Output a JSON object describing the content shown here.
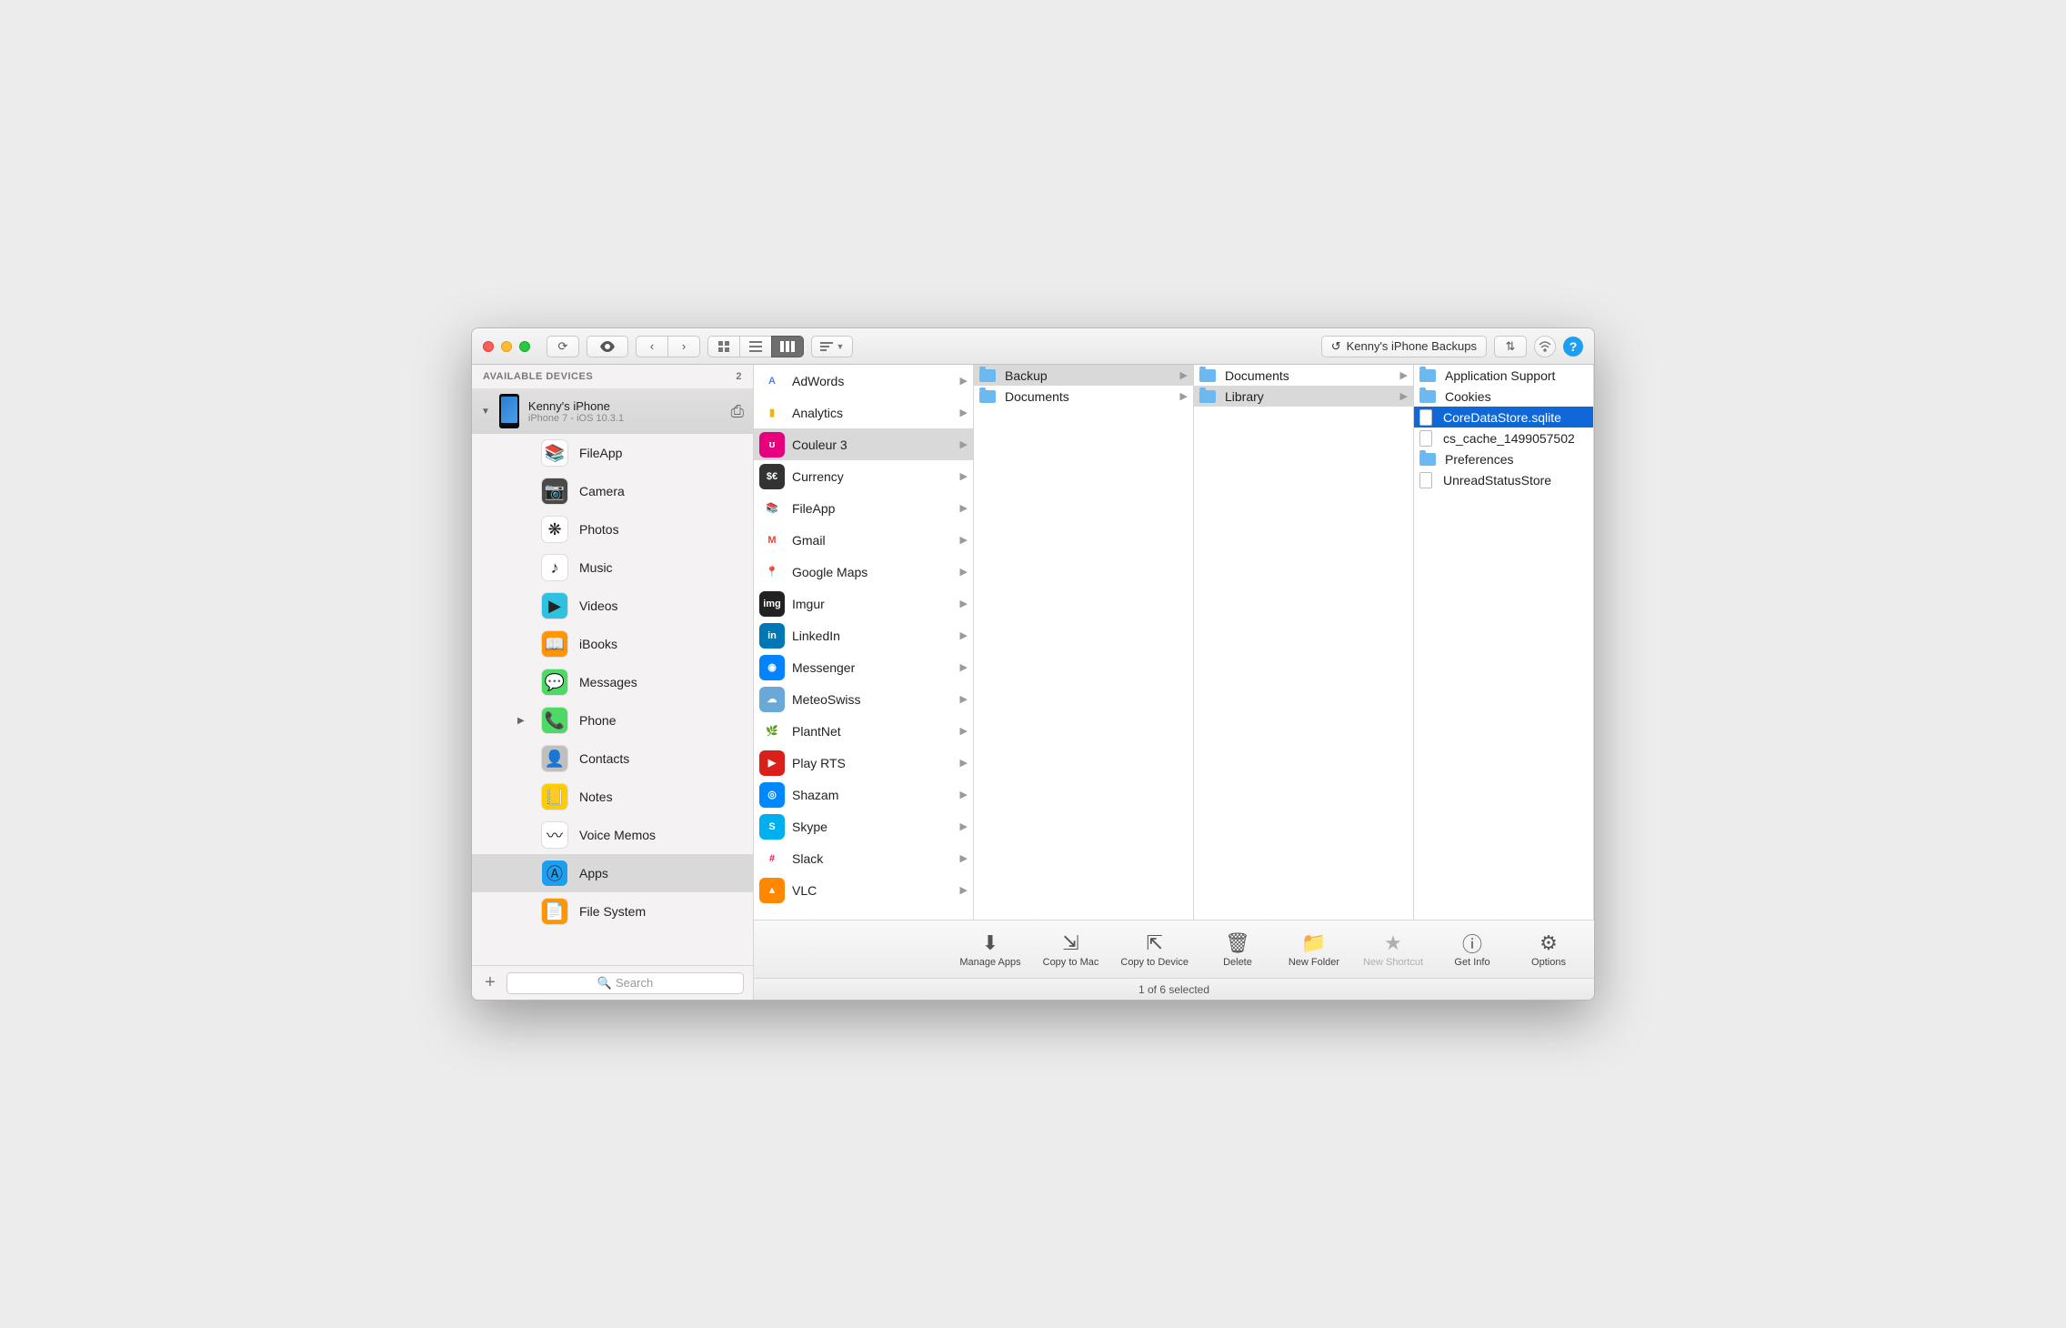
{
  "titlebar": {
    "backups_label": "Kenny's iPhone Backups"
  },
  "sidebar": {
    "header": "AVAILABLE DEVICES",
    "device_count": "2",
    "device_name": "Kenny's iPhone",
    "device_sub": "iPhone 7 - iOS 10.3.1",
    "items": [
      {
        "label": "FileApp",
        "icon": "📚",
        "bg": "#ffffff",
        "sel": false
      },
      {
        "label": "Camera",
        "icon": "📷",
        "bg": "#4a4a4a",
        "sel": false
      },
      {
        "label": "Photos",
        "icon": "❋",
        "bg": "#ffffff",
        "sel": false
      },
      {
        "label": "Music",
        "icon": "♪",
        "bg": "#ffffff",
        "sel": false
      },
      {
        "label": "Videos",
        "icon": "▶",
        "bg": "#2ec1e0",
        "sel": false
      },
      {
        "label": "iBooks",
        "icon": "📖",
        "bg": "#ff9500",
        "sel": false
      },
      {
        "label": "Messages",
        "icon": "💬",
        "bg": "#4cd964",
        "sel": false
      },
      {
        "label": "Phone",
        "icon": "📞",
        "bg": "#4cd964",
        "sel": false,
        "chev": true
      },
      {
        "label": "Contacts",
        "icon": "👤",
        "bg": "#bfbfbf",
        "sel": false
      },
      {
        "label": "Notes",
        "icon": "📒",
        "bg": "#ffcc00",
        "sel": false
      },
      {
        "label": "Voice Memos",
        "icon": "〰",
        "bg": "#ffffff",
        "sel": false
      },
      {
        "label": "Apps",
        "icon": "Ⓐ",
        "bg": "#1e9ef0",
        "sel": true
      },
      {
        "label": "File System",
        "icon": "📄",
        "bg": "#ff9500",
        "sel": false
      }
    ],
    "search_placeholder": "Search"
  },
  "col1": [
    {
      "label": "AdWords",
      "bg": "#ffffff",
      "txt": "A",
      "tc": "#4285f4"
    },
    {
      "label": "Analytics",
      "bg": "#ffffff",
      "txt": "▮",
      "tc": "#f4b400"
    },
    {
      "label": "Couleur 3",
      "bg": "#e6007e",
      "txt": "ʊ",
      "tc": "#fff",
      "sel": true
    },
    {
      "label": "Currency",
      "bg": "#333",
      "txt": "$€",
      "tc": "#fff"
    },
    {
      "label": "FileApp",
      "bg": "#fff",
      "txt": "📚",
      "tc": "#333"
    },
    {
      "label": "Gmail",
      "bg": "#fff",
      "txt": "M",
      "tc": "#ea4335"
    },
    {
      "label": "Google Maps",
      "bg": "#fff",
      "txt": "📍",
      "tc": "#ea4335"
    },
    {
      "label": "Imgur",
      "bg": "#222",
      "txt": "img",
      "tc": "#fff"
    },
    {
      "label": "LinkedIn",
      "bg": "#0077b5",
      "txt": "in",
      "tc": "#fff"
    },
    {
      "label": "Messenger",
      "bg": "#0084ff",
      "txt": "◉",
      "tc": "#fff"
    },
    {
      "label": "MeteoSwiss",
      "bg": "#6aa8d8",
      "txt": "☁",
      "tc": "#fff"
    },
    {
      "label": "PlantNet",
      "bg": "#fff",
      "txt": "🌿",
      "tc": "#4a8"
    },
    {
      "label": "Play RTS",
      "bg": "#d9201a",
      "txt": "▶",
      "tc": "#fff"
    },
    {
      "label": "Shazam",
      "bg": "#08f",
      "txt": "◎",
      "tc": "#fff"
    },
    {
      "label": "Skype",
      "bg": "#00aff0",
      "txt": "S",
      "tc": "#fff"
    },
    {
      "label": "Slack",
      "bg": "#fff",
      "txt": "#",
      "tc": "#e01563"
    },
    {
      "label": "VLC",
      "bg": "#ff8800",
      "txt": "▲",
      "tc": "#fff"
    }
  ],
  "col2": [
    {
      "label": "Backup",
      "type": "folder",
      "sel": true
    },
    {
      "label": "Documents",
      "type": "folder"
    }
  ],
  "col3": [
    {
      "label": "Documents",
      "type": "folder"
    },
    {
      "label": "Library",
      "type": "folder",
      "sel": true
    }
  ],
  "col4": [
    {
      "label": "Application Support",
      "type": "folder"
    },
    {
      "label": "Cookies",
      "type": "folder"
    },
    {
      "label": "CoreDataStore.sqlite",
      "type": "file",
      "hl": true
    },
    {
      "label": "cs_cache_1499057502",
      "type": "file"
    },
    {
      "label": "Preferences",
      "type": "folder"
    },
    {
      "label": "UnreadStatusStore",
      "type": "file"
    }
  ],
  "bottombar": [
    {
      "label": "Manage Apps",
      "icon": "⬇"
    },
    {
      "label": "Copy to Mac",
      "icon": "⇲"
    },
    {
      "label": "Copy to Device",
      "icon": "⇱"
    },
    {
      "label": "Delete",
      "icon": "🗑"
    },
    {
      "label": "New Folder",
      "icon": "📁"
    },
    {
      "label": "New Shortcut",
      "icon": "★",
      "dis": true
    },
    {
      "label": "Get Info",
      "icon": "ⓘ"
    },
    {
      "label": "Options",
      "icon": "⚙"
    }
  ],
  "status": "1 of 6 selected"
}
